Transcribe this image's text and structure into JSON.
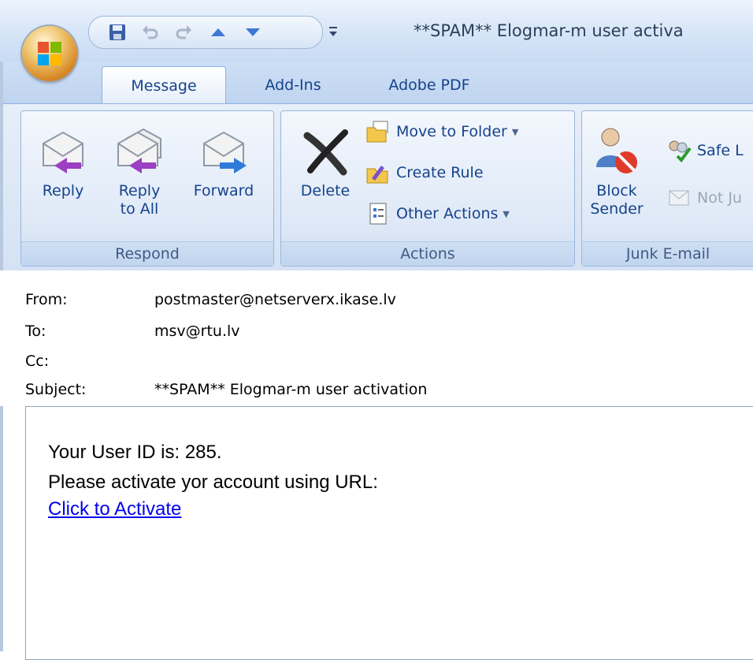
{
  "window": {
    "title": "**SPAM** Elogmar-m user activa"
  },
  "quick_access": {
    "items": [
      "save-icon",
      "undo-icon",
      "redo-icon",
      "previous-item-icon",
      "next-item-icon",
      "customize-icon"
    ]
  },
  "tabs": [
    {
      "label": "Message",
      "active": true
    },
    {
      "label": "Add-Ins",
      "active": false
    },
    {
      "label": "Adobe PDF",
      "active": false
    }
  ],
  "ribbon": {
    "respond": {
      "label": "Respond",
      "reply": "Reply",
      "reply_all_1": "Reply",
      "reply_all_2": "to All",
      "forward": "Forward"
    },
    "actions": {
      "label": "Actions",
      "delete": "Delete",
      "move_to_folder": "Move to Folder",
      "create_rule": "Create Rule",
      "other_actions": "Other Actions"
    },
    "junk": {
      "label": "Junk E-mail",
      "block_1": "Block",
      "block_2": "Sender",
      "safe": "Safe L",
      "not_junk": "Not Ju"
    },
    "dropdown_glyph": "▼"
  },
  "header": {
    "from_label": "From:",
    "from_value": "postmaster@netserverx.ikase.lv",
    "to_label": "To:",
    "to_value": "msv@rtu.lv",
    "cc_label": "Cc:",
    "cc_value": "",
    "subject_label": "Subject:",
    "subject_value": "**SPAM** Elogmar-m user activation"
  },
  "body": {
    "line1": "Your User ID is: 285.",
    "line2": "Please activate yor account using URL:",
    "link": "Click to Activate"
  },
  "colors": {
    "link": "#0000ee",
    "ribbon_text": "#15428b",
    "ribbon_border": "#9ab6dc"
  }
}
